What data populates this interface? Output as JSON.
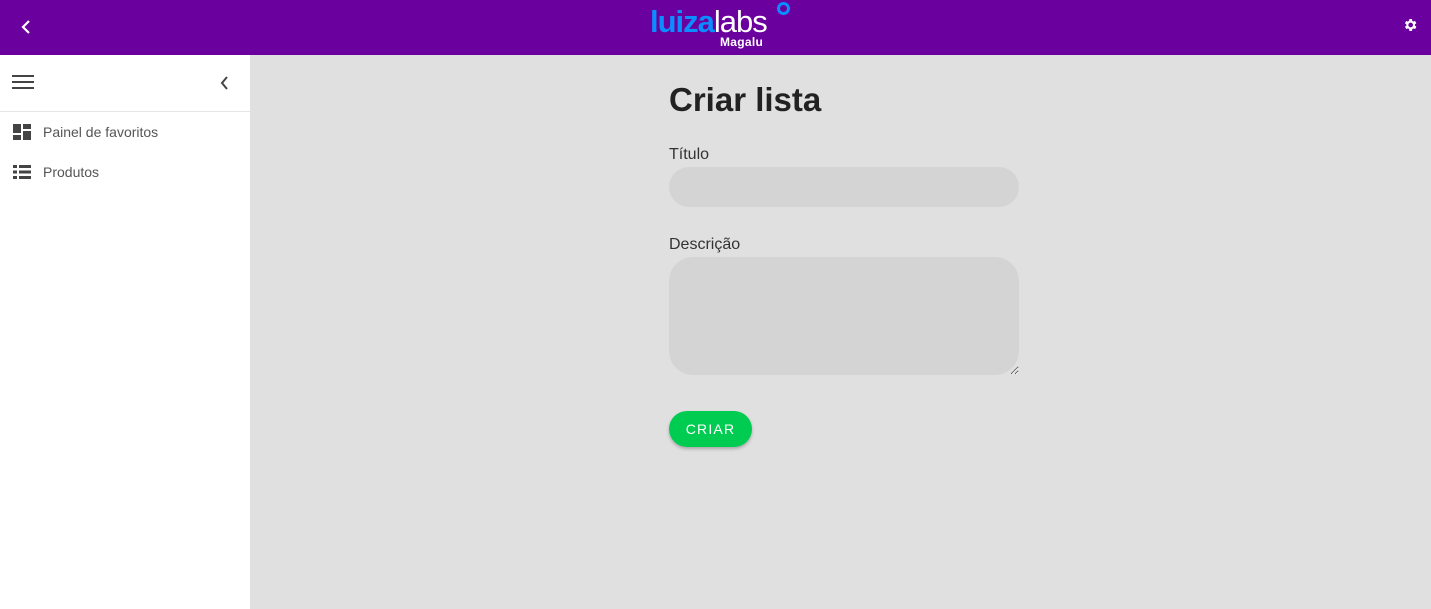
{
  "header": {
    "logo": {
      "brand_main": "luiza",
      "brand_light": "labs",
      "brand_sub": "Magalu"
    },
    "back_icon": "chevron-left-icon",
    "settings_icon": "gear-icon"
  },
  "sidebar": {
    "menu_icon": "hamburger-menu-icon",
    "collapse_icon": "chevron-left-icon",
    "items": [
      {
        "label": "Painel de favoritos",
        "icon": "dashboard-icon"
      },
      {
        "label": "Produtos",
        "icon": "list-icon"
      }
    ]
  },
  "form": {
    "title": "Criar lista",
    "title_label": "Título",
    "title_value": "",
    "description_label": "Descrição",
    "description_value": "",
    "submit_label": "CRIAR"
  },
  "colors": {
    "header_bg": "#6a009e",
    "brand_blue": "#0b8cff",
    "button_green": "#00cc52",
    "content_bg": "#e0e0e0",
    "input_bg": "#d4d4d4"
  }
}
